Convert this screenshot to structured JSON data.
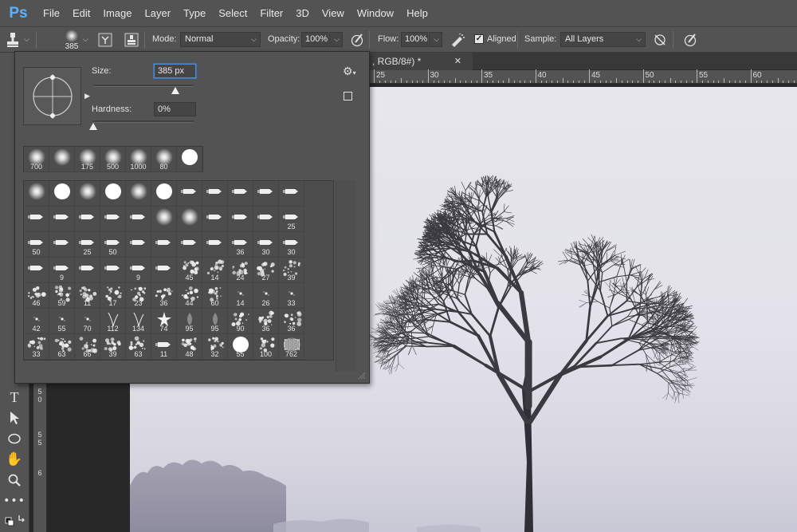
{
  "app": {
    "logo": "Ps"
  },
  "menu": [
    "File",
    "Edit",
    "Image",
    "Layer",
    "Type",
    "Select",
    "Filter",
    "3D",
    "View",
    "Window",
    "Help"
  ],
  "options": {
    "brush_size": "385",
    "mode_label": "Mode:",
    "mode_value": "Normal",
    "opacity_label": "Opacity:",
    "opacity_value": "100%",
    "flow_label": "Flow:",
    "flow_value": "100%",
    "aligned_label": "Aligned",
    "aligned_checked": true,
    "sample_label": "Sample:",
    "sample_value": "All Layers"
  },
  "document": {
    "tab_title": ", RGB/8#) *",
    "tab_close": "✕",
    "hruler_labels": [
      "25",
      "30",
      "35",
      "40",
      "45",
      "50",
      "55",
      "60"
    ],
    "vruler_labels": [
      "4\n5",
      "5\n0",
      "5\n5",
      "6"
    ]
  },
  "brush_picker": {
    "size_label": "Size:",
    "size_value": "385 px",
    "size_fraction": 0.82,
    "hardness_label": "Hardness:",
    "hardness_value": "0%",
    "hardness_fraction": 0.0,
    "recent": [
      {
        "label": "700",
        "kind": "soft"
      },
      {
        "label": "",
        "kind": "soft"
      },
      {
        "label": "175",
        "kind": "soft"
      },
      {
        "label": "500",
        "kind": "soft"
      },
      {
        "label": "1000",
        "kind": "soft"
      },
      {
        "label": "80",
        "kind": "soft"
      },
      {
        "label": "",
        "kind": "hard"
      }
    ],
    "presets": [
      [
        {
          "l": "",
          "k": "soft"
        },
        {
          "l": "",
          "k": "hard"
        },
        {
          "l": "",
          "k": "soft"
        },
        {
          "l": "",
          "k": "hard"
        },
        {
          "l": "",
          "k": "soft"
        },
        {
          "l": "",
          "k": "hard"
        },
        {
          "l": "",
          "k": "tip"
        },
        {
          "l": "",
          "k": "tip"
        },
        {
          "l": "",
          "k": "tip"
        },
        {
          "l": "",
          "k": "tip"
        },
        {
          "l": "",
          "k": "tip"
        }
      ],
      [
        {
          "l": "",
          "k": "tip"
        },
        {
          "l": "",
          "k": "tip"
        },
        {
          "l": "",
          "k": "tip"
        },
        {
          "l": "",
          "k": "tip"
        },
        {
          "l": "",
          "k": "tip"
        },
        {
          "l": "",
          "k": "soft"
        },
        {
          "l": "",
          "k": "soft"
        },
        {
          "l": "",
          "k": "tip"
        },
        {
          "l": "",
          "k": "tip"
        },
        {
          "l": "",
          "k": "tip"
        },
        {
          "l": "25",
          "k": "tip"
        }
      ],
      [
        {
          "l": "50",
          "k": "tip"
        },
        {
          "l": "",
          "k": "tip"
        },
        {
          "l": "25",
          "k": "tip"
        },
        {
          "l": "50",
          "k": "tip"
        },
        {
          "l": "",
          "k": "tip"
        },
        {
          "l": "",
          "k": "tip"
        },
        {
          "l": "",
          "k": "tip"
        },
        {
          "l": "",
          "k": "tip"
        },
        {
          "l": "36",
          "k": "tip"
        },
        {
          "l": "30",
          "k": "tip"
        },
        {
          "l": "30",
          "k": "tip"
        }
      ],
      [
        {
          "l": "",
          "k": "tip"
        },
        {
          "l": "9",
          "k": "tip"
        },
        {
          "l": "",
          "k": "tip"
        },
        {
          "l": "",
          "k": "tip"
        },
        {
          "l": "9",
          "k": "tip"
        },
        {
          "l": "",
          "k": "tip"
        },
        {
          "l": "45",
          "k": "splat"
        },
        {
          "l": "14",
          "k": "splat"
        },
        {
          "l": "24",
          "k": "splat"
        },
        {
          "l": "27",
          "k": "splat"
        },
        {
          "l": "39",
          "k": "splat"
        }
      ],
      [
        {
          "l": "46",
          "k": "splat"
        },
        {
          "l": "59",
          "k": "splat"
        },
        {
          "l": "11",
          "k": "splat"
        },
        {
          "l": "17",
          "k": "splat"
        },
        {
          "l": "23",
          "k": "splat"
        },
        {
          "l": "36",
          "k": "splat"
        },
        {
          "l": "44",
          "k": "splat"
        },
        {
          "l": "60",
          "k": "splat"
        },
        {
          "l": "14",
          "k": "dot"
        },
        {
          "l": "26",
          "k": "dot"
        },
        {
          "l": "33",
          "k": "dot"
        }
      ],
      [
        {
          "l": "42",
          "k": "dot"
        },
        {
          "l": "55",
          "k": "dot"
        },
        {
          "l": "70",
          "k": "dot"
        },
        {
          "l": "112",
          "k": "grass"
        },
        {
          "l": "134",
          "k": "grass"
        },
        {
          "l": "74",
          "k": "star"
        },
        {
          "l": "95",
          "k": "drop"
        },
        {
          "l": "95",
          "k": "drop"
        },
        {
          "l": "90",
          "k": "splat"
        },
        {
          "l": "36",
          "k": "splat"
        },
        {
          "l": "36",
          "k": "splat"
        }
      ],
      [
        {
          "l": "33",
          "k": "splat"
        },
        {
          "l": "63",
          "k": "splat"
        },
        {
          "l": "66",
          "k": "splat"
        },
        {
          "l": "39",
          "k": "splat"
        },
        {
          "l": "63",
          "k": "splat"
        },
        {
          "l": "11",
          "k": "tip"
        },
        {
          "l": "48",
          "k": "splat"
        },
        {
          "l": "32",
          "k": "splat"
        },
        {
          "l": "55",
          "k": "hard"
        },
        {
          "l": "100",
          "k": "splat"
        },
        {
          "l": "762",
          "k": "stripe"
        }
      ]
    ]
  },
  "colors": {
    "panel": "#535353",
    "canvas_bg": "#e4e3ea",
    "accent": "#59b2ff"
  }
}
